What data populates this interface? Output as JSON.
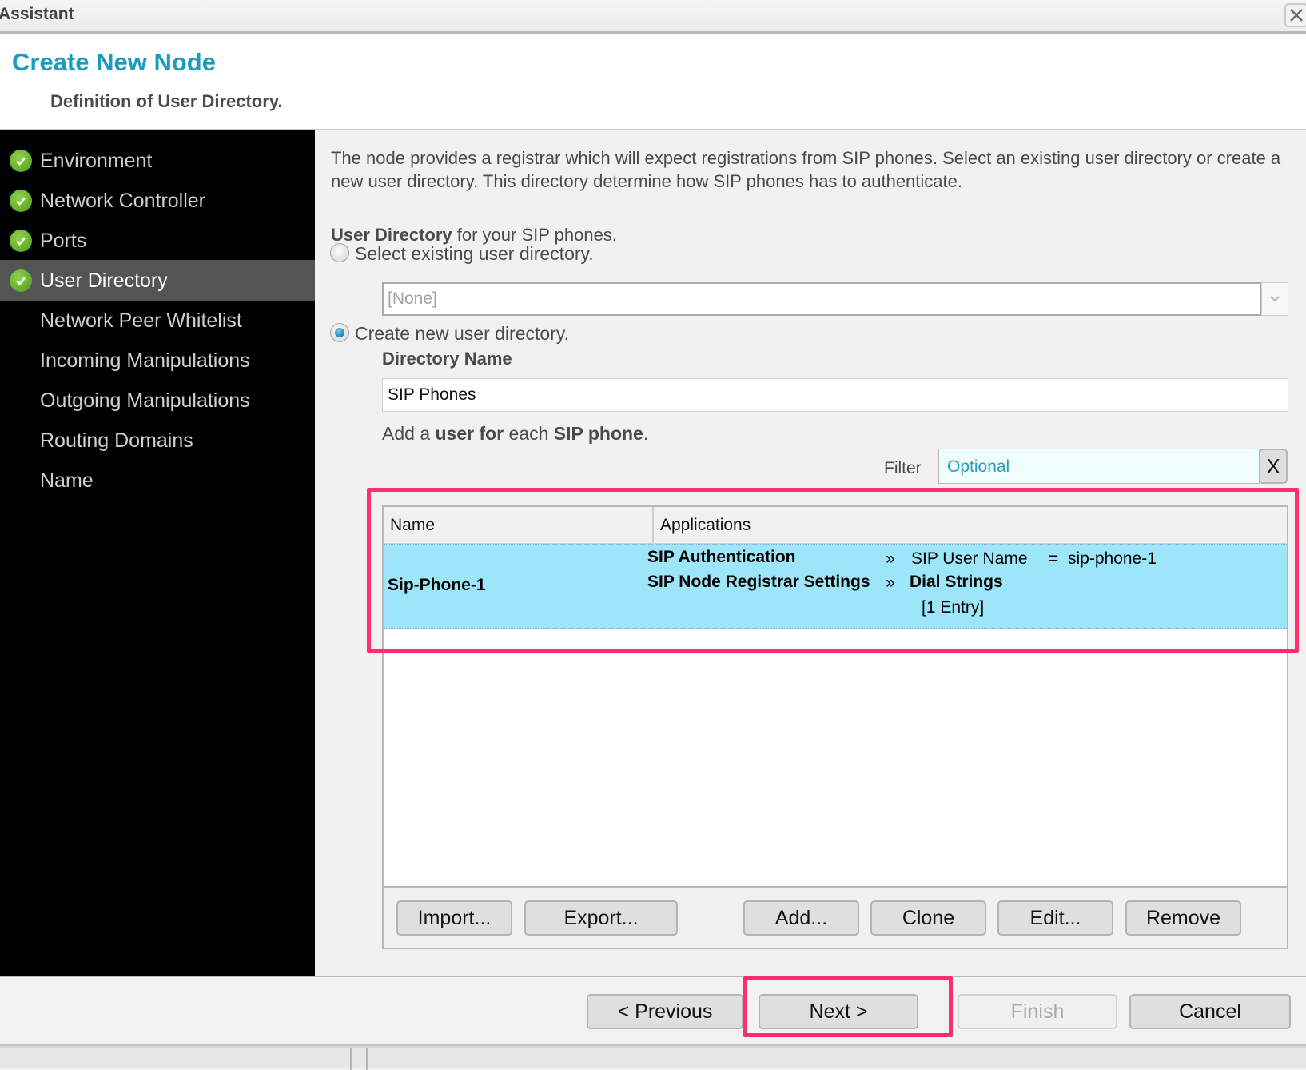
{
  "window": {
    "title": "Assistant",
    "close_icon": "close-icon"
  },
  "header": {
    "title": "Create New Node",
    "subtitle": "Definition of User Directory."
  },
  "sidebar": {
    "items": [
      {
        "label": "Environment",
        "completed": true,
        "active": false
      },
      {
        "label": "Network Controller",
        "completed": true,
        "active": false
      },
      {
        "label": "Ports",
        "completed": true,
        "active": false
      },
      {
        "label": "User Directory",
        "completed": true,
        "active": true
      },
      {
        "label": "Network Peer Whitelist",
        "completed": false,
        "active": false
      },
      {
        "label": "Incoming Manipulations",
        "completed": false,
        "active": false
      },
      {
        "label": "Outgoing Manipulations",
        "completed": false,
        "active": false
      },
      {
        "label": "Routing Domains",
        "completed": false,
        "active": false
      },
      {
        "label": "Name",
        "completed": false,
        "active": false
      }
    ]
  },
  "main": {
    "description": "The node provides a registrar which will expect registrations from SIP phones. Select an existing user directory or create a new user directory. This directory determine how SIP phones has to authenticate.",
    "user_directory_label_bold": "User Directory",
    "user_directory_label_rest": " for your SIP phones.",
    "option_existing": {
      "label": "Select existing user directory.",
      "selected": false
    },
    "existing_combo_value": "[None]",
    "option_new": {
      "label": "Create new user directory.",
      "selected": true
    },
    "directory_name_label": "Directory Name",
    "directory_name_value": "SIP Phones",
    "add_user_hint": {
      "p1": "Add a ",
      "b1": "user for",
      "p2": " each ",
      "b2": "SIP phone",
      "p3": "."
    },
    "filter": {
      "label": "Filter",
      "placeholder": "Optional",
      "clear_label": "X"
    },
    "table": {
      "columns": [
        "Name",
        "Applications"
      ],
      "rows": [
        {
          "name": "Sip-Phone-1",
          "applications": [
            {
              "app": "SIP Authentication",
              "arrow": "»",
              "key": "SIP User Name",
              "eq": "=",
              "value": "sip-phone-1"
            },
            {
              "app": "SIP Node Registrar Settings",
              "arrow": "»",
              "key": "Dial Strings",
              "value": "[1 Entry]"
            }
          ]
        }
      ]
    },
    "table_buttons": {
      "import": "Import...",
      "export": "Export...",
      "add": "Add...",
      "clone": "Clone",
      "edit": "Edit...",
      "remove": "Remove"
    }
  },
  "footer": {
    "previous": "< Previous",
    "next": "Next >",
    "finish": "Finish",
    "cancel": "Cancel"
  },
  "colors": {
    "accent": "#1d9bbd",
    "selected_row": "#9de5f8",
    "highlight": "#ff2f6d",
    "sidebar_bg": "#000000",
    "sidebar_active": "#545454"
  }
}
